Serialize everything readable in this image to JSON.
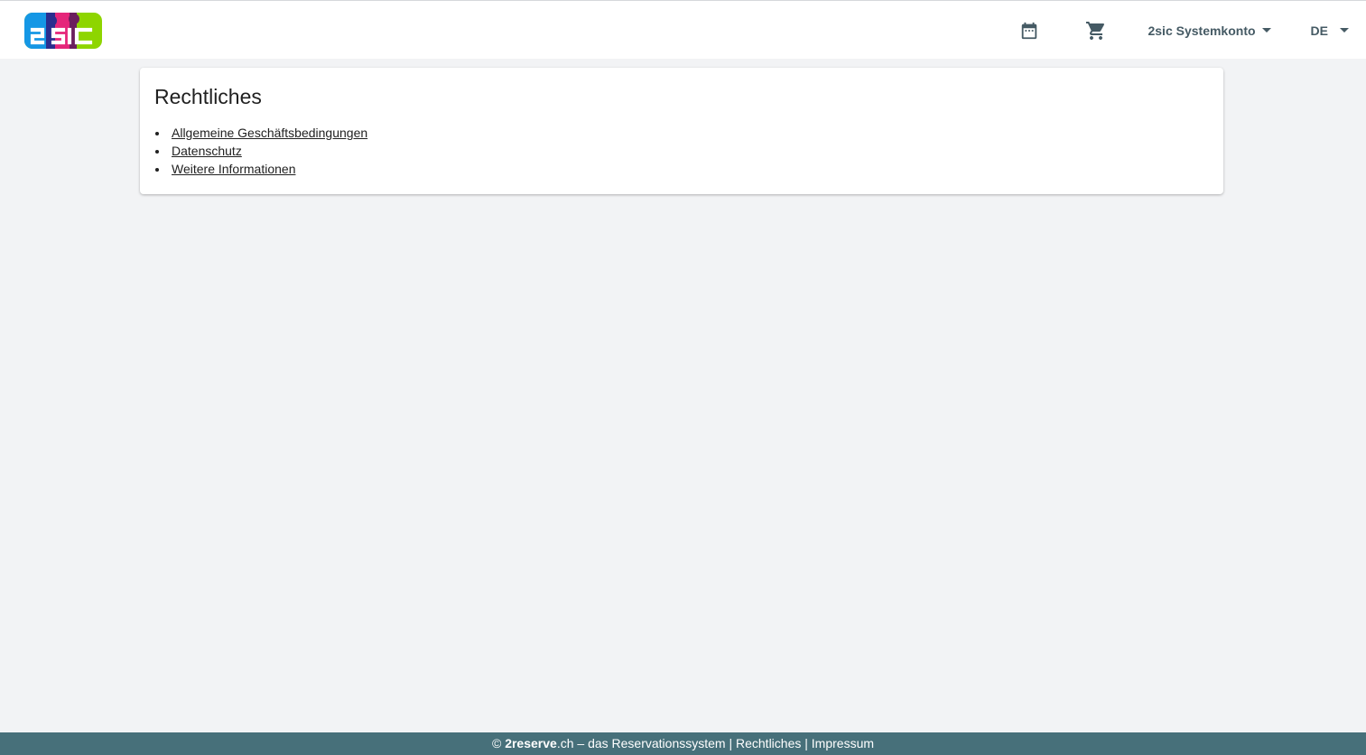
{
  "header": {
    "logo_text": "2sic",
    "account_label": "2sic Systemkonto",
    "language_label": "DE",
    "icons": {
      "calendar": "calendar-icon",
      "cart": "shopping-cart-icon",
      "caret": "caret-down-icon"
    }
  },
  "main": {
    "title": "Rechtliches",
    "links": [
      {
        "label": "Allgemeine Geschäftsbedingungen"
      },
      {
        "label": "Datenschutz"
      },
      {
        "label": "Weitere Informationen"
      }
    ]
  },
  "footer": {
    "copyright": "©",
    "brand_bold": "2reserve",
    "brand_suffix": ".ch",
    "tagline": " – das Reservationssystem",
    "separator": "|",
    "link_legal": "Rechtliches",
    "link_imprint": "Impressum"
  },
  "colors": {
    "accent": "#455a64",
    "footer_bg": "#47707a",
    "page_bg": "#f2f3f5"
  }
}
